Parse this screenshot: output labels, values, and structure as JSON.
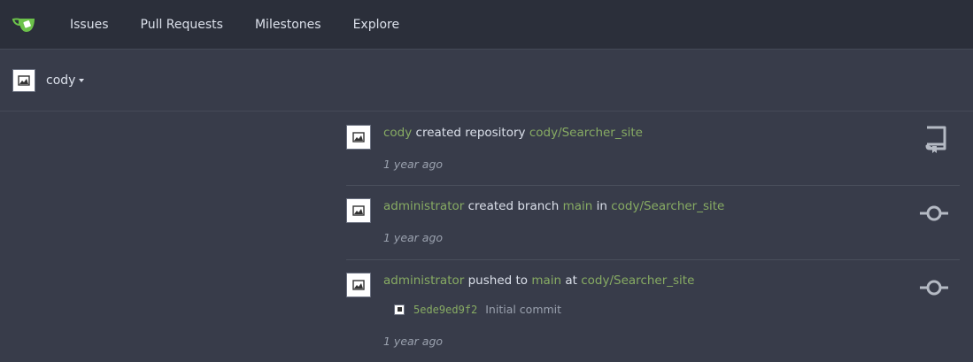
{
  "nav": {
    "logo_icon": "gitea-logo-icon",
    "items": [
      "Issues",
      "Pull Requests",
      "Milestones",
      "Explore"
    ]
  },
  "context": {
    "user": "cody"
  },
  "feed": [
    {
      "actor": "cody",
      "action": "created repository",
      "repo": "cody/Searcher_site",
      "time": "1 year ago",
      "icon": "repo-icon"
    },
    {
      "actor": "administrator",
      "action": "created branch",
      "branch": "main",
      "preposition": "in",
      "repo": "cody/Searcher_site",
      "time": "1 year ago",
      "icon": "commit-icon"
    },
    {
      "actor": "administrator",
      "action": "pushed to",
      "branch": "main",
      "preposition": "at",
      "repo": "cody/Searcher_site",
      "commit": {
        "sha": "5ede9ed9f2",
        "message": "Initial commit"
      },
      "time": "1 year ago",
      "icon": "commit-icon"
    }
  ],
  "colors": {
    "background": "#383c4a",
    "nav": "#2b2f3a",
    "link": "#87ab63",
    "muted": "#9aa1ae"
  }
}
